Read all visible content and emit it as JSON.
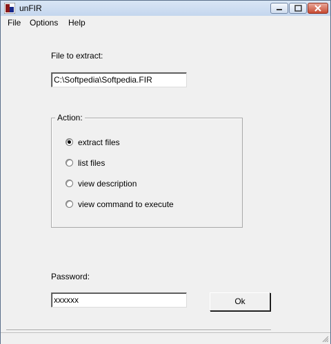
{
  "window": {
    "title": "unFIR"
  },
  "menu": {
    "file": "File",
    "options": "Options",
    "help": "Help"
  },
  "file_section": {
    "label": "File to extract:",
    "value": "C:\\Softpedia\\Softpedia.FIR"
  },
  "action": {
    "legend": "Action:",
    "options": [
      {
        "label": "extract files",
        "checked": true
      },
      {
        "label": "list files",
        "checked": false
      },
      {
        "label": "view description",
        "checked": false
      },
      {
        "label": "view command to execute",
        "checked": false
      }
    ]
  },
  "password": {
    "label": "Password:",
    "value": "xxxxxx"
  },
  "ok_button": {
    "label": "Ok"
  },
  "icons": {
    "app": "unfir-app-icon",
    "minimize": "minimize-icon",
    "maximize": "maximize-icon",
    "close": "close-icon"
  }
}
